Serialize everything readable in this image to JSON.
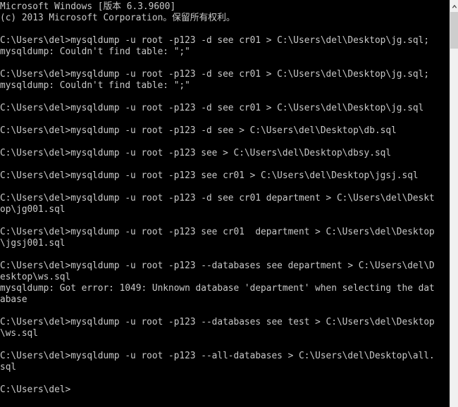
{
  "window": {
    "title": "Command Prompt",
    "background_color": "#000000",
    "text_color": "#c8c8c8",
    "columns": 80
  },
  "scrollbar": {
    "up_arrow_icon": "chevron-up-icon",
    "thumb_position_percent": 0,
    "thumb_size_percent": 9
  },
  "console": {
    "prompt": "C:\\Users\\del>",
    "lines": [
      "Microsoft Windows [版本 6.3.9600]",
      "(c) 2013 Microsoft Corporation。保留所有权利。",
      "",
      "C:\\Users\\del>mysqldump -u root -p123 -d see cr01 > C:\\Users\\del\\Desktop\\jg.sql;",
      "mysqldump: Couldn't find table: \";\"",
      "",
      "C:\\Users\\del>mysqldump -u root -p123 -d see cr01 > C:\\Users\\del\\Desktop\\jg.sql;",
      "mysqldump: Couldn't find table: \";\"",
      "",
      "C:\\Users\\del>mysqldump -u root -p123 -d see cr01 > C:\\Users\\del\\Desktop\\jg.sql",
      "",
      "C:\\Users\\del>mysqldump -u root -p123 -d see > C:\\Users\\del\\Desktop\\db.sql",
      "",
      "C:\\Users\\del>mysqldump -u root -p123 see > C:\\Users\\del\\Desktop\\dbsy.sql",
      "",
      "C:\\Users\\del>mysqldump -u root -p123 see cr01 > C:\\Users\\del\\Desktop\\jgsj.sql",
      "",
      "C:\\Users\\del>mysqldump -u root -p123 -d see cr01 department > C:\\Users\\del\\Deskt",
      "op\\jg001.sql",
      "",
      "C:\\Users\\del>mysqldump -u root -p123 see cr01  department > C:\\Users\\del\\Desktop",
      "\\jgsj001.sql",
      "",
      "C:\\Users\\del>mysqldump -u root -p123 --databases see department > C:\\Users\\del\\D",
      "esktop\\ws.sql",
      "mysqldump: Got error: 1049: Unknown database 'department' when selecting the dat",
      "abase",
      "",
      "C:\\Users\\del>mysqldump -u root -p123 --databases see test > C:\\Users\\del\\Desktop",
      "\\ws.sql",
      "",
      "C:\\Users\\del>mysqldump -u root -p123 --all-databases > C:\\Users\\del\\Desktop\\all.",
      "sql",
      "",
      "C:\\Users\\del>"
    ]
  }
}
